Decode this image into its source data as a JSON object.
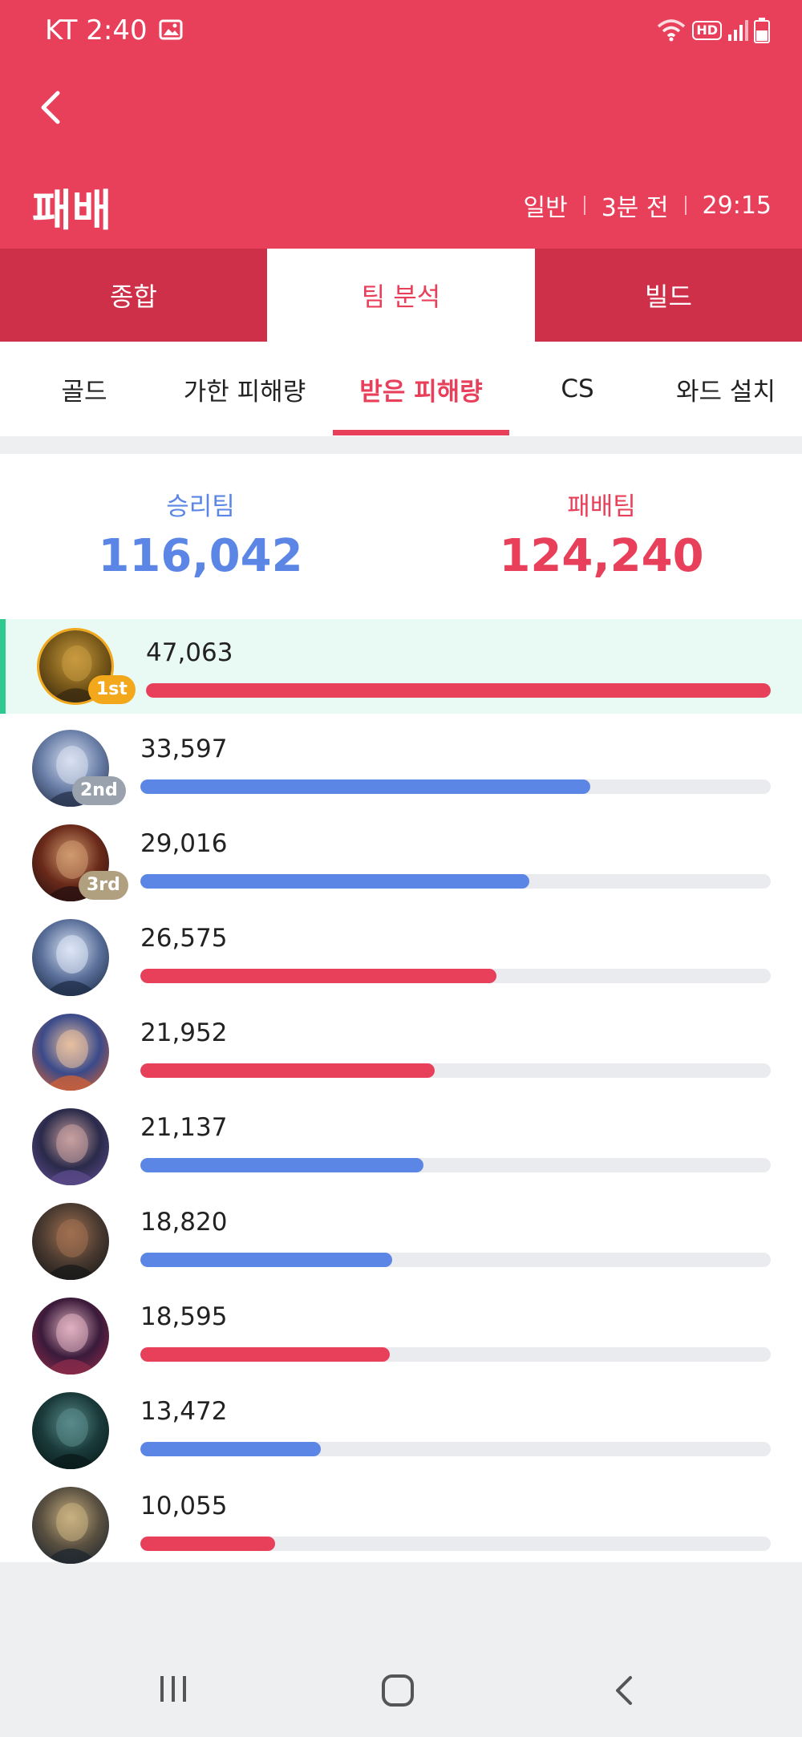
{
  "status_bar": {
    "time": "KT 2:40",
    "hd": "HD",
    "icons": [
      "gallery-icon",
      "wifi-icon",
      "hd-voice-icon",
      "signal-icon",
      "battery-icon"
    ]
  },
  "header": {
    "title": "패배",
    "meta": [
      "일반",
      "3분 전",
      "29:15"
    ]
  },
  "main_tabs": [
    "종합",
    "팀 분석",
    "빌드"
  ],
  "sub_tabs": [
    "골드",
    "가한 피해량",
    "받은 피해량",
    "CS",
    "와드 설치"
  ],
  "summary": {
    "win_label": "승리팀",
    "win_total": "116,042",
    "loss_label": "패배팀",
    "loss_total": "124,240"
  },
  "rows": [
    {
      "value": "47,063",
      "amount": 47063,
      "team": "loss",
      "rank": "1st"
    },
    {
      "value": "33,597",
      "amount": 33597,
      "team": "win",
      "rank": "2nd"
    },
    {
      "value": "29,016",
      "amount": 29016,
      "team": "win",
      "rank": "3rd"
    },
    {
      "value": "26,575",
      "amount": 26575,
      "team": "loss",
      "rank": ""
    },
    {
      "value": "21,952",
      "amount": 21952,
      "team": "loss",
      "rank": ""
    },
    {
      "value": "21,137",
      "amount": 21137,
      "team": "win",
      "rank": ""
    },
    {
      "value": "18,820",
      "amount": 18820,
      "team": "win",
      "rank": ""
    },
    {
      "value": "18,595",
      "amount": 18595,
      "team": "loss",
      "rank": ""
    },
    {
      "value": "13,472",
      "amount": 13472,
      "team": "win",
      "rank": ""
    },
    {
      "value": "10,055",
      "amount": 10055,
      "team": "loss",
      "rank": ""
    }
  ],
  "max_amount": 47063,
  "colors": {
    "accent": "#e8405a",
    "win": "#5b86e5",
    "loss": "#e8405a",
    "highlight": "#e8faf3",
    "gold": "#f3a81c"
  },
  "nav": [
    "recent-apps-icon",
    "home-icon",
    "back-icon"
  ]
}
